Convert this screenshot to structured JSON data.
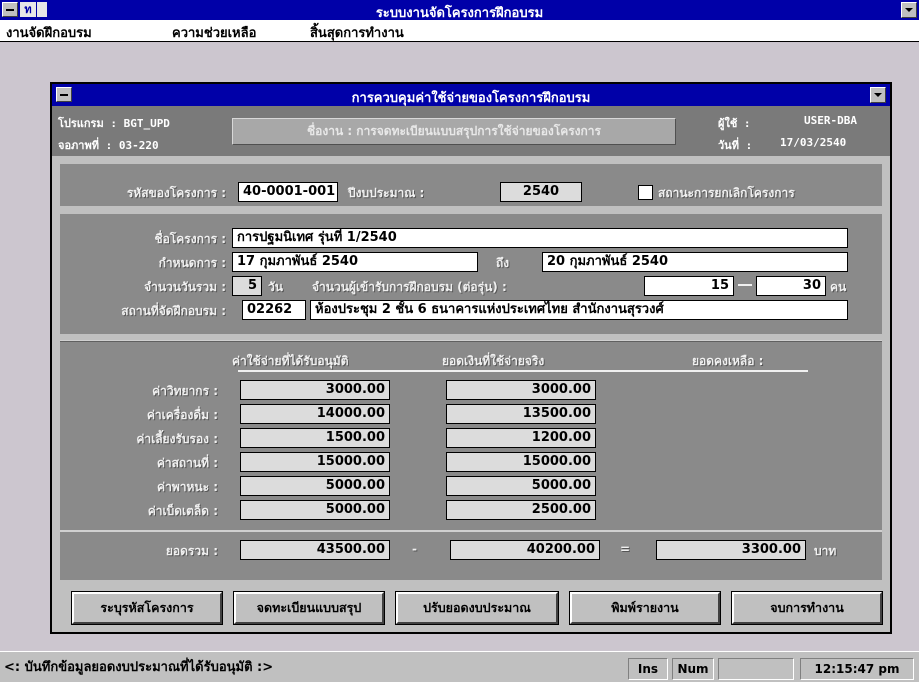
{
  "app": {
    "title": "ระบบงานจัดโครงการฝึกอบรม",
    "icon_letter": "ท"
  },
  "menu": {
    "items": [
      "งานจัดฝึกอบรม",
      "ความช่วยเหลือ",
      "สิ้นสุดการทำงาน"
    ]
  },
  "dialog": {
    "title": "การควบคุมค่าใช้จ่ายของโครงการฝึกอบรม",
    "program_label": "โปรแกรม : BGT_UPD",
    "screen_label": "จอภาพที่ : 03-220",
    "module_text": "ชื่องาน : การจดทะเบียนแบบสรุปการใช้จ่ายของโครงการ",
    "user_label": "ผู้ใช้ :",
    "user_value": "USER-DBA",
    "date_label": "วันที่ :",
    "date_value": "17/03/2540"
  },
  "form": {
    "project_code_label": "รหัสของโครงการ :",
    "project_code": "40-0001-001",
    "budget_year_label": "ปีงบประมาณ :",
    "budget_year": "2540",
    "cancel_status_label": "สถานะการยกเลิกโครงการ",
    "project_name_label": "ชื่อโครงการ :",
    "project_name": "การปฐมนิเทศ รุ่นที่ 1/2540",
    "schedule_label": "กำหนดการ :",
    "start_date": "17 กุมภาพันธ์ 2540",
    "to_label": "ถึง",
    "end_date": "20 กุมภาพันธ์ 2540",
    "total_days_label": "จำนวนวันรวม :",
    "total_days": "5",
    "days_unit": "วัน",
    "trainees_label": "จำนวนผู้เข้ารับการฝึกอบรม (ต่อรุ่น) :",
    "trainees_min": "15",
    "trainees_max": "30",
    "trainees_unit": "คน",
    "venue_label": "สถานที่จัดฝึกอบรม :",
    "venue_code": "02262",
    "venue_name": "ห้องประชุม 2  ชั้น 6  ธนาคารแห่งประเทศไทย  สำนักงานสุรวงศ์"
  },
  "expenses": {
    "col_approved": "ค่าใช้จ่ายที่ได้รับอนุมัติ",
    "col_actual": "ยอดเงินที่ใช้จ่ายจริง",
    "col_remaining": "ยอดคงเหลือ :",
    "rows": [
      {
        "label": "ค่าวิทยากร :",
        "approved": "3000.00",
        "actual": "3000.00"
      },
      {
        "label": "ค่าเครื่องดื่ม :",
        "approved": "14000.00",
        "actual": "13500.00"
      },
      {
        "label": "ค่าเลี้ยงรับรอง :",
        "approved": "1500.00",
        "actual": "1200.00"
      },
      {
        "label": "ค่าสถานที่ :",
        "approved": "15000.00",
        "actual": "15000.00"
      },
      {
        "label": "ค่าพาหนะ :",
        "approved": "5000.00",
        "actual": "5000.00"
      },
      {
        "label": "ค่าเบ็ดเตล็ด :",
        "approved": "5000.00",
        "actual": "2500.00"
      }
    ],
    "total_label": "ยอดรวม :",
    "total_approved": "43500.00",
    "minus": "-",
    "total_actual": "40200.00",
    "equals": "=",
    "total_remaining": "3300.00",
    "currency": "บาท"
  },
  "buttons": {
    "specify_project": "ระบุรหัสโครงการ",
    "register_summary": "จดทะเบียนแบบสรุป",
    "adjust_budget": "ปรับยอดงบประมาณ",
    "print_report": "พิมพ์รายงาน",
    "end_work": "จบการทำงาน"
  },
  "status": {
    "message": "<: บันทึกข้อมูลยอดงบประมาณที่ได้รับอนุมัติ :>",
    "ins": "Ins",
    "num": "Num",
    "blank": "",
    "time": "12:15:47 pm"
  }
}
